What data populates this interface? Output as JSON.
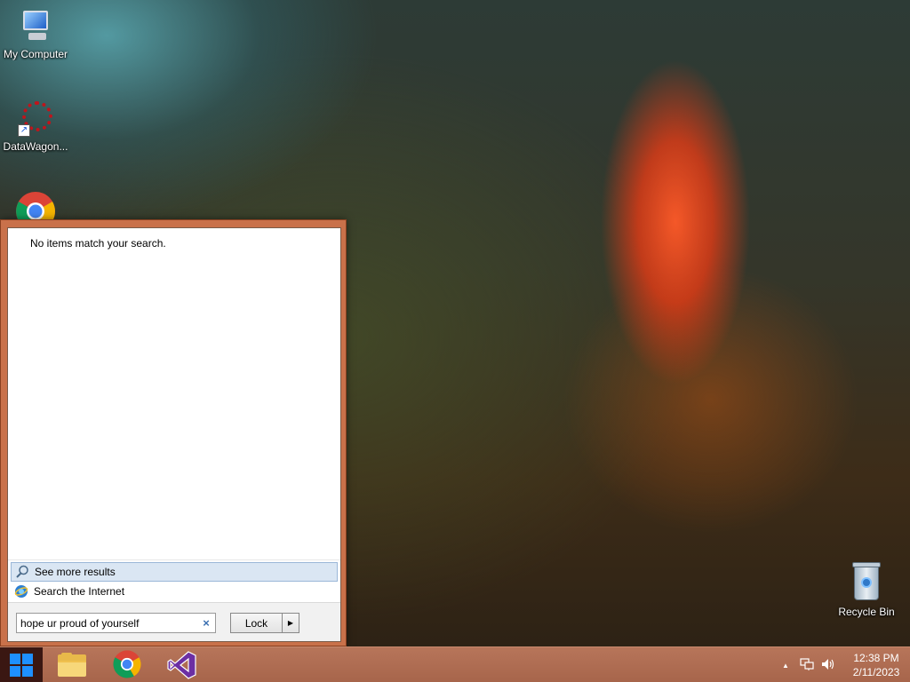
{
  "desktop": {
    "icons": [
      {
        "label": "My Computer",
        "icon": "computer-icon"
      },
      {
        "label": "DataWagon...",
        "icon": "datawagon-icon"
      },
      {
        "label": "",
        "icon": "chrome-icon"
      },
      {
        "label": "Recycle Bin",
        "icon": "recycle-bin-icon"
      }
    ]
  },
  "start_menu": {
    "no_results_text": "No items match your search.",
    "see_more_results": "See more results",
    "search_internet": "Search the Internet",
    "search_value": "hope ur proud of yourself",
    "clear_glyph": "×",
    "lock_label": "Lock",
    "lock_arrow_glyph": "▶"
  },
  "taskbar": {
    "apps": [
      "file-explorer-icon",
      "chrome-icon",
      "visual-studio-icon"
    ],
    "tray": {
      "show_hidden_glyph": "▲",
      "network_icon": "network-icon",
      "volume_icon": "volume-icon"
    },
    "clock": {
      "time": "12:38 PM",
      "date": "2/11/2023"
    }
  },
  "colors": {
    "start_menu_frame": "#c9714a",
    "taskbar": "#a7654b",
    "start_button": "#3a1712",
    "win_logo": "#1e90ff",
    "selected_row": "#dae6f3"
  }
}
